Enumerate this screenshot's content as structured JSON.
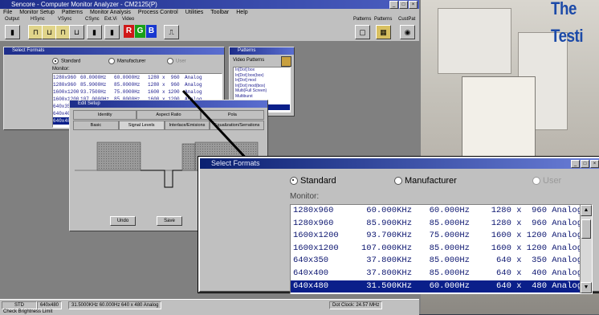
{
  "headline": {
    "line1": "The",
    "line2": "Testi"
  },
  "app": {
    "title": "Sencore - Computer Monitor Analyzer - CM2125(P)",
    "menu": [
      "File",
      "Monitor Setup",
      "Patterns",
      "Monitor Analysis",
      "Process Control",
      "Utilities",
      "Toolbar",
      "Help"
    ],
    "toolbar_groups": [
      "Output",
      "HSync",
      "VSync",
      "CSync",
      "Ext.Vi",
      "Video",
      "Patterns",
      "Patterns",
      "CustPat"
    ],
    "rgb": [
      "R",
      "G",
      "B"
    ]
  },
  "formats_small": {
    "title": "Select Formats",
    "radio_standard": "Standard",
    "radio_manufacturer": "Manufacturer",
    "radio_user": "User",
    "monitor_label": "Monitor:",
    "rows": [
      [
        "1280x960",
        "60.0000Hz",
        "60.0000Hz",
        "1280 x  960",
        "Analog"
      ],
      [
        "1280x960",
        "85.9000Hz",
        "85.0000Hz",
        "1280 x  960",
        "Analog"
      ],
      [
        "1600x1200",
        "93.7500Hz",
        "75.0000Hz",
        "1600 x 1200",
        "Analog"
      ],
      [
        "1600x1200",
        "107.0000Hz",
        "85.0000Hz",
        "1600 x 1200",
        "Analog"
      ],
      [
        "640x350",
        "37.8000Hz",
        "85.0000Hz",
        " 640 x  350",
        "Analog"
      ],
      [
        "640x400",
        "37.8000Hz",
        "85.0000Hz",
        " 640 x  400",
        "Analog"
      ],
      [
        "640x480",
        "31.5000Hz",
        "60.0000Hz",
        " 640 x  480",
        "Analog"
      ]
    ]
  },
  "patterns_window": {
    "title": "Patterns",
    "label": "Video Patterns",
    "items": [
      "In[Dot] box",
      "In[Dot] box(box)",
      "In[Dot] mod",
      "In[Dot] mod(box)",
      "Multi(Full Screen)",
      "Multiburst",
      "Raster[Black]",
      "Raster[White]"
    ]
  },
  "edit_setup": {
    "title": "Edit Setup",
    "tabs_top": [
      "Identity",
      "Aspect Ratio",
      "Pola"
    ],
    "tabs_bottom": [
      "Basic",
      "Signal Levels",
      "Interlace/Emisions",
      "Equalization/Serrations"
    ],
    "undo": "Undo",
    "save": "Save"
  },
  "zoom": {
    "title": "Select Formats",
    "radio_standard": "Standard",
    "radio_manufacturer": "Manufacturer",
    "radio_user": "User",
    "monitor_label": "Monitor:",
    "rows": [
      [
        "1280x960",
        "60.000KHz",
        "60.000Hz",
        "1280 x  960",
        "Analog"
      ],
      [
        "1280x960",
        "85.900KHz",
        "85.000Hz",
        "1280 x  960",
        "Analog"
      ],
      [
        "1600x1200",
        "93.700KHz",
        "75.000Hz",
        "1600 x 1200",
        "Analog"
      ],
      [
        "1600x1200",
        "107.000KHz",
        "85.000Hz",
        "1600 x 1200",
        "Analog"
      ],
      [
        "640x350",
        "37.800KHz",
        "85.000Hz",
        " 640 x  350",
        "Analog"
      ],
      [
        "640x400",
        "37.800KHz",
        "85.000Hz",
        " 640 x  400",
        "Analog"
      ],
      [
        "640x480",
        "31.500KHz",
        "60.000Hz",
        " 640 x  480",
        "Analog"
      ]
    ],
    "selected_index": 6
  },
  "status": {
    "segments": [
      "STD",
      "640x480",
      "31.5000KHz  60.000Hz   640 x 480   Analog"
    ],
    "right": "Dot Clock:  24.57  MHz",
    "bottom_left": "Check Brightness Limit"
  }
}
